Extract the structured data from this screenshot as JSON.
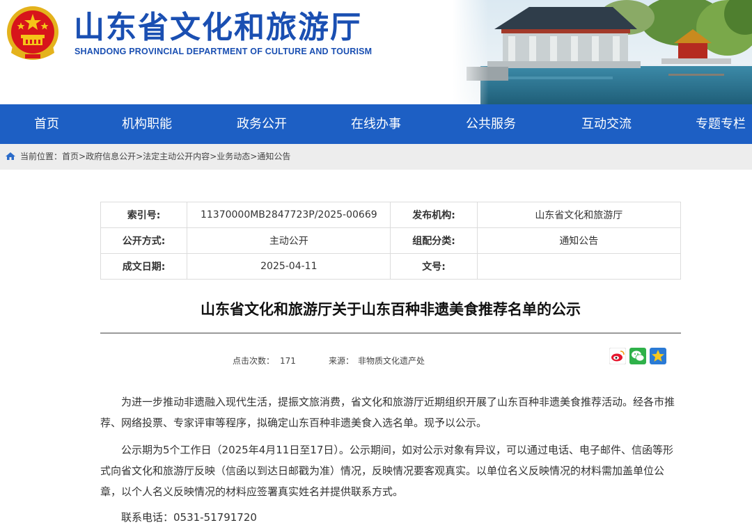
{
  "header": {
    "title": "山东省文化和旅游厅",
    "subtitle": "SHANDONG PROVINCIAL DEPARTMENT OF CULTURE AND TOURISM",
    "emblem_icon": "national-emblem-icon"
  },
  "nav": {
    "items": [
      {
        "label": "首页"
      },
      {
        "label": "机构职能"
      },
      {
        "label": "政务公开"
      },
      {
        "label": "在线办事"
      },
      {
        "label": "公共服务"
      },
      {
        "label": "互动交流"
      },
      {
        "label": "专题专栏"
      }
    ]
  },
  "breadcrumb": {
    "prefix": "当前位置：",
    "items": [
      "首页",
      "政府信息公开",
      "法定主动公开内容",
      "业务动态",
      "通知公告"
    ],
    "separator": ">"
  },
  "meta": {
    "index_label": "索引号:",
    "index_value": "11370000MB2847723P/2025-00669",
    "publisher_label": "发布机构:",
    "publisher_value": "山东省文化和旅游厅",
    "mode_label": "公开方式:",
    "mode_value": "主动公开",
    "category_label": "组配分类:",
    "category_value": "通知公告",
    "date_label": "成文日期:",
    "date_value": "2025-04-11",
    "docno_label": "文号:",
    "docno_value": ""
  },
  "article": {
    "title": "山东省文化和旅游厅关于山东百种非遗美食推荐名单的公示",
    "hits_label": "点击次数：",
    "hits_value": "171",
    "source_label": "来源：",
    "source_value": "非物质文化遗产处",
    "share_icons": [
      "weibo-icon",
      "wechat-icon",
      "favorite-star-icon"
    ],
    "paragraphs": [
      "为进一步推动非遗融入现代生活，提振文旅消费，省文化和旅游厅近期组织开展了山东百种非遗美食推荐活动。经各市推荐、网络投票、专家评审等程序，拟确定山东百种非遗美食入选名单。现予以公示。",
      "公示期为5个工作日（2025年4月11日至17日）。公示期间，如对公示对象有异议，可以通过电话、电子邮件、信函等形式向省文化和旅游厅反映（信函以到达日邮戳为准）情况，反映情况要客观真实。以单位名义反映情况的材料需加盖单位公章，以个人名义反映情况的材料应签署真实姓名并提供联系方式。",
      "联系电话：0531-51791720"
    ]
  },
  "colors": {
    "brand_blue": "#1a4fb2",
    "nav_blue": "#1d5fc4",
    "breadcrumb_bg": "#ededed",
    "emblem_red": "#d7151b",
    "emblem_gold": "#f5c518"
  }
}
